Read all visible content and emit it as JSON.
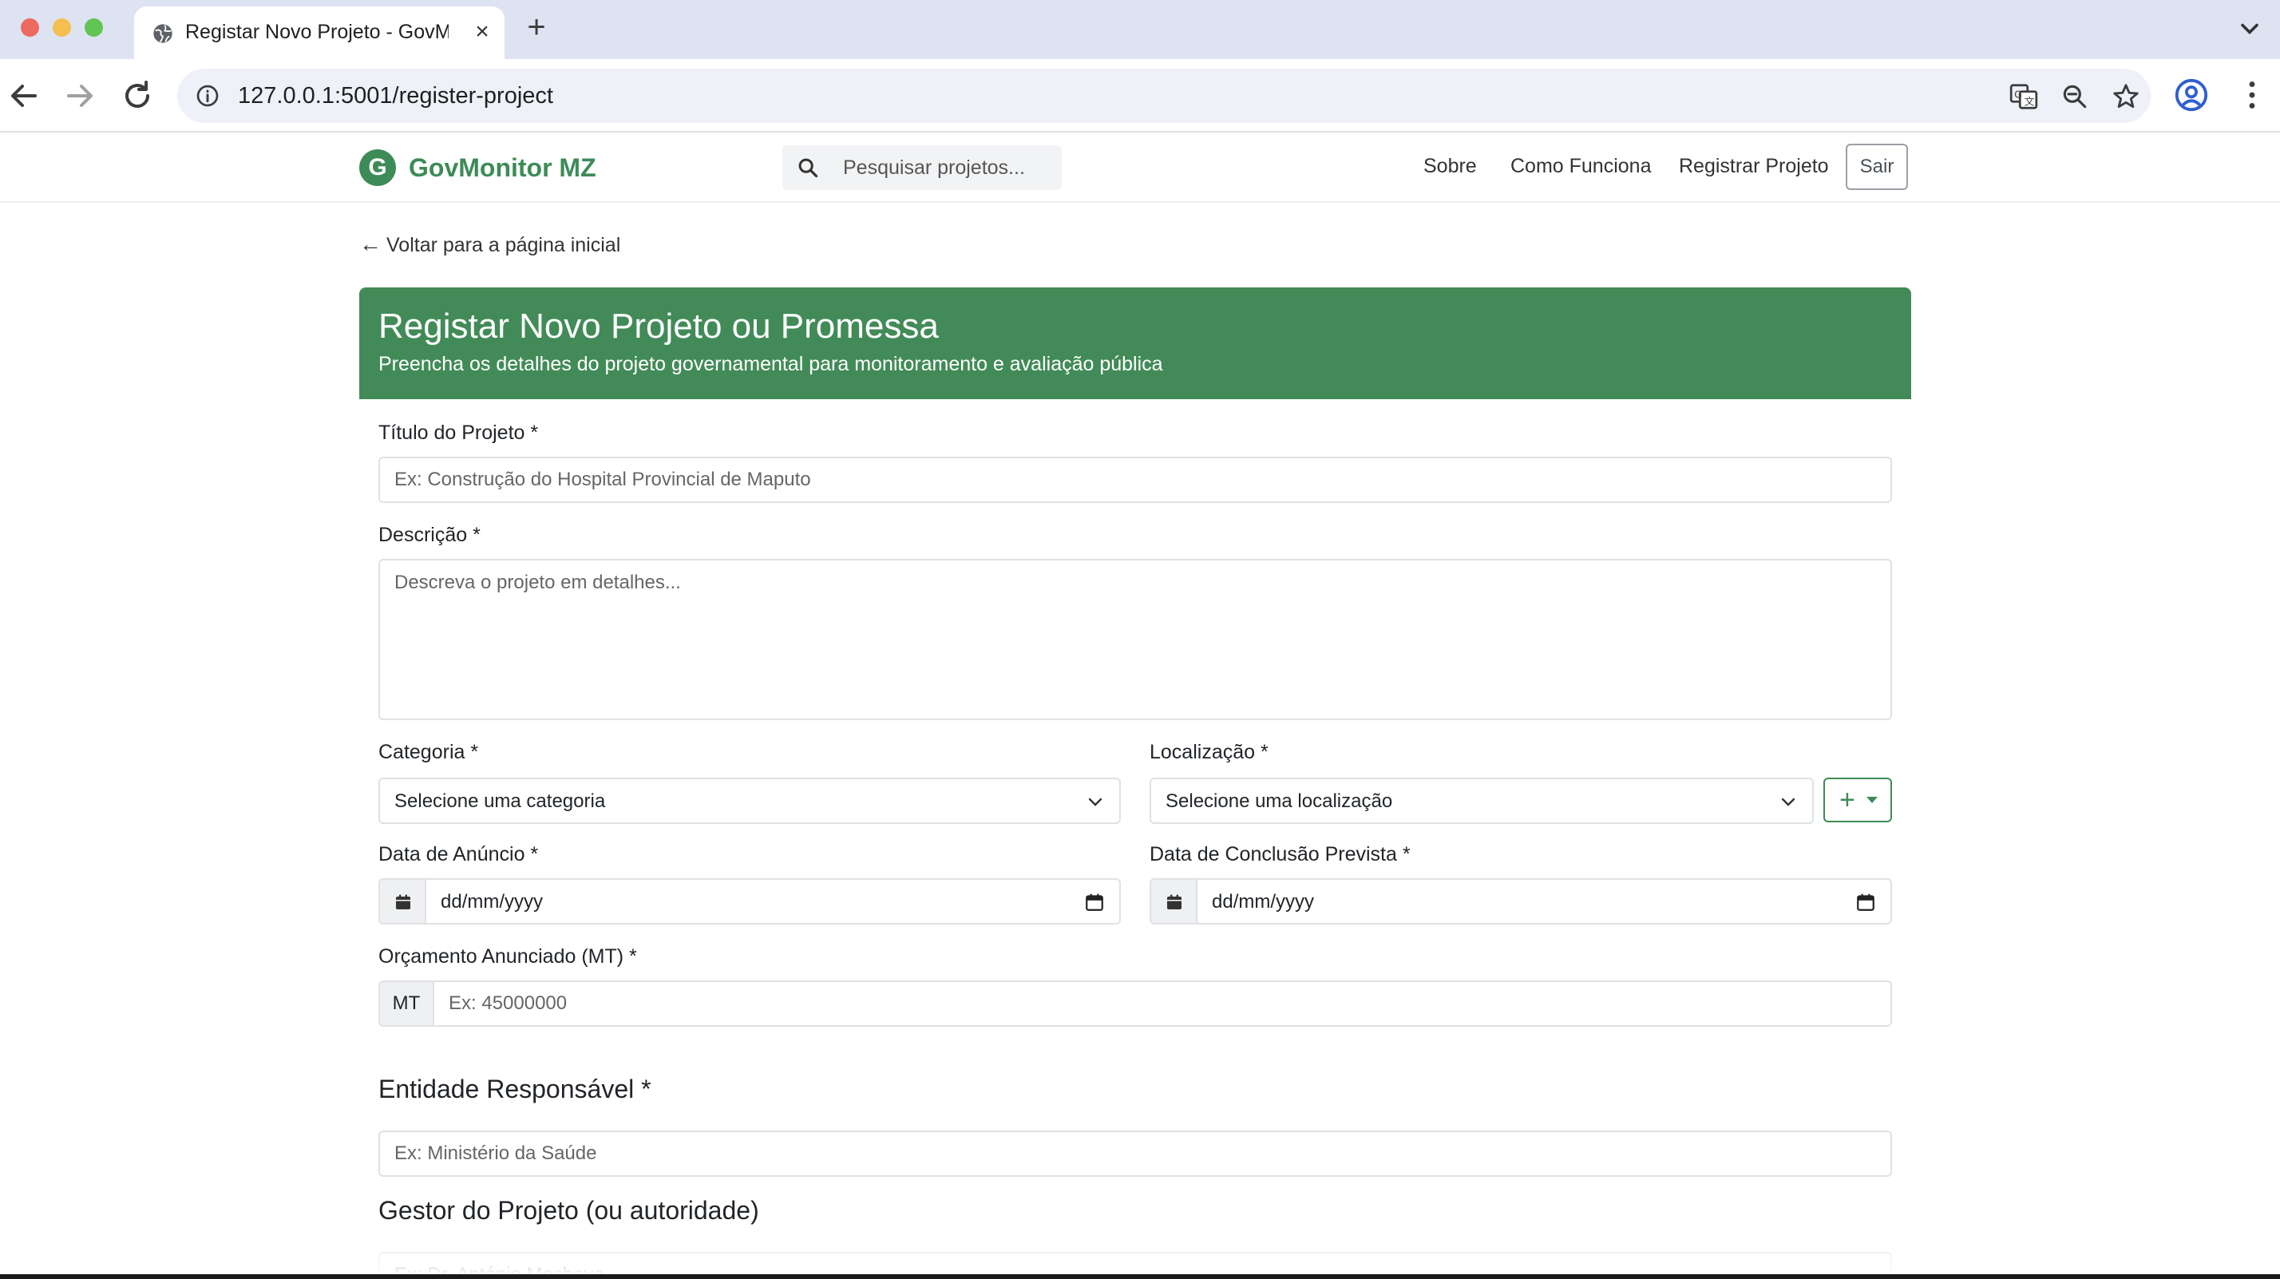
{
  "browser": {
    "tab_title": "Registar Novo Projeto - GovMonitor MZ",
    "url": "127.0.0.1:5001/register-project"
  },
  "site": {
    "brand_letter": "G",
    "brand_name": "GovMonitor MZ",
    "search_placeholder": "Pesquisar projetos...",
    "nav": {
      "about": "Sobre",
      "how": "Como Funciona",
      "register": "Registrar Projeto",
      "logout": "Sair"
    }
  },
  "page": {
    "back_link": "Voltar para a página inicial",
    "title": "Registar Novo Projeto ou Promessa",
    "subtitle": "Preencha os detalhes do projeto governamental para monitoramento e avaliação pública"
  },
  "form": {
    "title_label": "Título do Projeto *",
    "title_placeholder": "Ex: Construção do Hospital Provincial de Maputo",
    "description_label": "Descrição *",
    "description_placeholder": "Descreva o projeto em detalhes...",
    "category_label": "Categoria *",
    "category_value": "Selecione uma categoria",
    "location_label": "Localização *",
    "location_value": "Selecione uma localização",
    "announce_date_label": "Data de Anúncio *",
    "announce_date_value": "dd/mm/yyyy",
    "completion_date_label": "Data de Conclusão Prevista *",
    "completion_date_value": "dd/mm/yyyy",
    "budget_label": "Orçamento Anunciado (MT) *",
    "budget_prefix": "MT",
    "budget_placeholder": "Ex: 45000000",
    "entity_heading": "Entidade Responsável *",
    "entity_placeholder": "Ex: Ministério da Saúde",
    "manager_heading": "Gestor do Projeto (ou autoridade)",
    "manager_placeholder": "Ex: Dr. António Machava"
  },
  "colors": {
    "brand_green": "#3d8b57",
    "header_green": "#428b58"
  }
}
